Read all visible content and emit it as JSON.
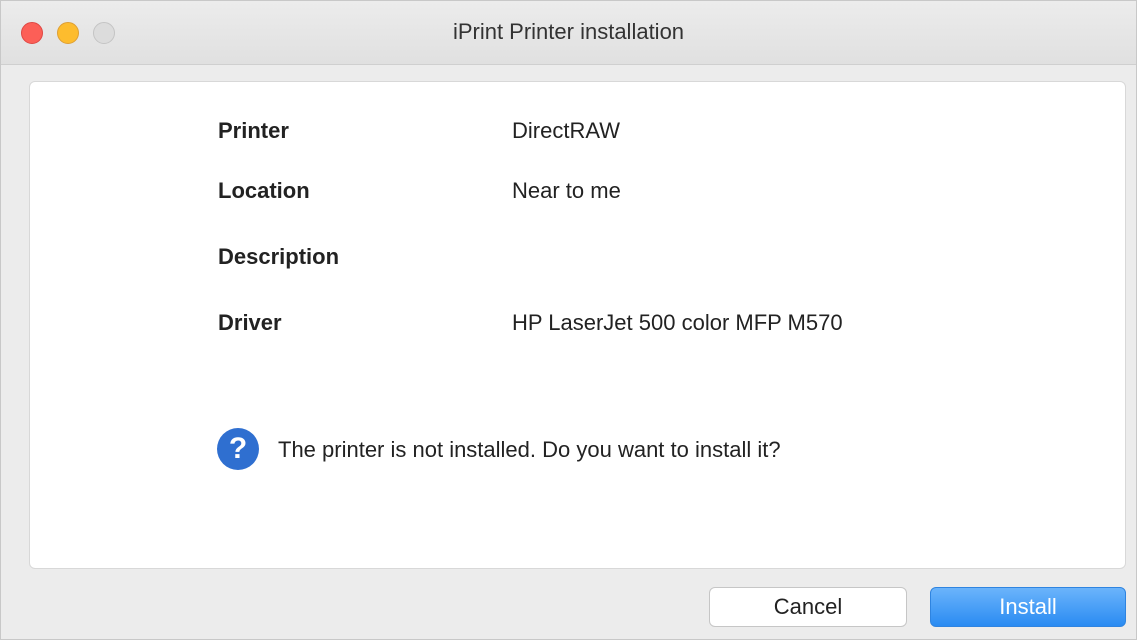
{
  "window": {
    "title": "iPrint Printer installation"
  },
  "details": [
    {
      "label": "Printer",
      "value": "DirectRAW"
    },
    {
      "label": "Location",
      "value": "Near to me"
    },
    {
      "label": "Description",
      "value": ""
    },
    {
      "label": "Driver",
      "value": "HP LaserJet 500 color MFP M570"
    }
  ],
  "prompt": {
    "icon": "question-icon",
    "glyph": "?",
    "message": "The printer is not installed. Do you want to install it?"
  },
  "buttons": {
    "cancel_label": "Cancel",
    "install_label": "Install"
  },
  "colors": {
    "accent": "#2a8bf2",
    "question_icon": "#2f6fd0"
  }
}
